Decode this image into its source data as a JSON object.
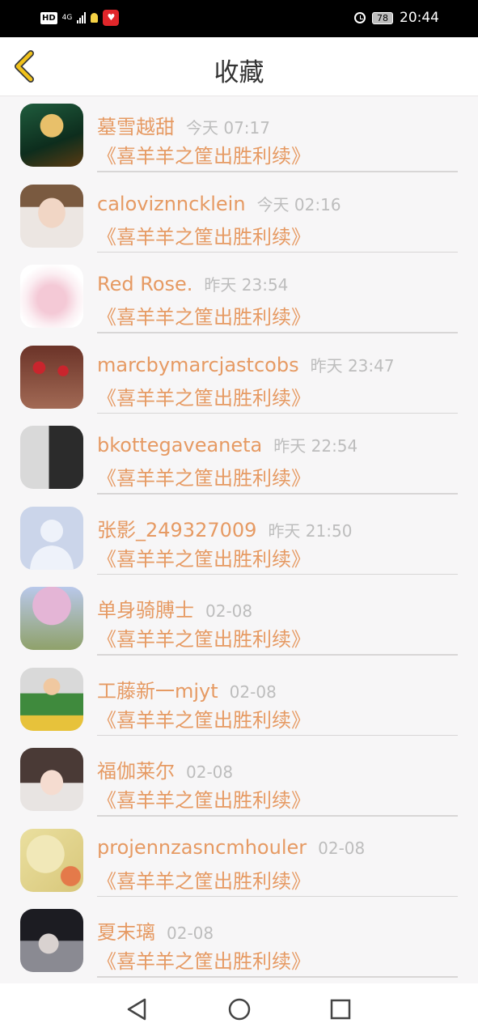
{
  "status_bar": {
    "hd": "HD",
    "network": "4G",
    "battery": "78",
    "time": "20:44"
  },
  "header": {
    "title": "收藏"
  },
  "favorites": [
    {
      "name": "墓雪越甜",
      "time": "今天 07:17",
      "message": "《喜羊羊之筐出胜利续》"
    },
    {
      "name": "caloviznncklein",
      "time": "今天 02:16",
      "message": "《喜羊羊之筐出胜利续》"
    },
    {
      "name": "Red Rose.",
      "time": "昨天 23:54",
      "message": "《喜羊羊之筐出胜利续》"
    },
    {
      "name": "marcbymarcjastcobs",
      "time": "昨天 23:47",
      "message": "《喜羊羊之筐出胜利续》"
    },
    {
      "name": "bkottegaveaneta",
      "time": "昨天 22:54",
      "message": "《喜羊羊之筐出胜利续》"
    },
    {
      "name": "张影_249327009",
      "time": "昨天 21:50",
      "message": "《喜羊羊之筐出胜利续》"
    },
    {
      "name": "单身骑膊士",
      "time": "02-08",
      "message": "《喜羊羊之筐出胜利续》"
    },
    {
      "name": "工藤新一mjyt",
      "time": "02-08",
      "message": "《喜羊羊之筐出胜利续》"
    },
    {
      "name": "福伽莱尔",
      "time": "02-08",
      "message": "《喜羊羊之筐出胜利续》"
    },
    {
      "name": "projennzasncmhouler",
      "time": "02-08",
      "message": "《喜羊羊之筐出胜利续》"
    },
    {
      "name": "夏末璃",
      "time": "02-08",
      "message": "《喜羊羊之筐出胜利续》"
    }
  ],
  "colors": {
    "accent": "#e69a63",
    "time_gray": "#bdbdbd",
    "back_arrow": "#f1c21b"
  }
}
